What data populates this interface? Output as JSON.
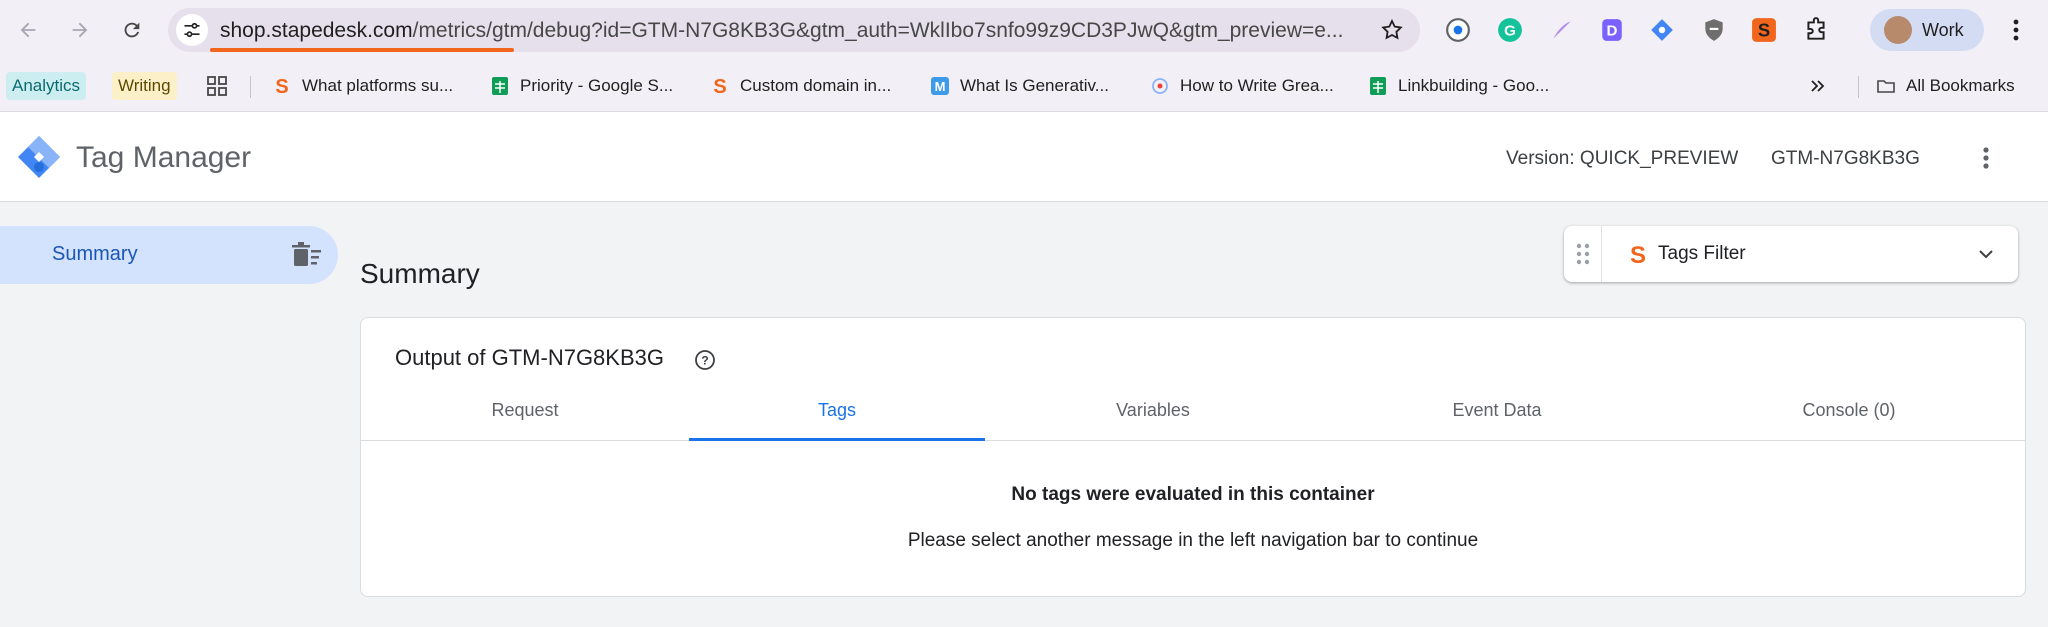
{
  "browser": {
    "url_host": "shop.stapedesk.com",
    "url_rest": "/metrics/gtm/debug?id=GTM-N7G8KB3G&gtm_auth=WklIbo7snfo99z9CD3PJwQ&gtm_preview=e...",
    "profile_label": "Work",
    "accent": "#f1661c"
  },
  "bookmarks": [
    {
      "label": "Analytics",
      "icon": "chip"
    },
    {
      "label": "Writing",
      "icon": "chip"
    },
    {
      "label": "What platforms su...",
      "icon": "stape-icon"
    },
    {
      "label": "Priority - Google S...",
      "icon": "sheets-icon"
    },
    {
      "label": "Custom domain in...",
      "icon": "stape-icon"
    },
    {
      "label": "What Is Generativ...",
      "icon": "m-icon"
    },
    {
      "label": "How to Write Grea...",
      "icon": "globe-icon"
    },
    {
      "label": "Linkbuilding - Goo...",
      "icon": "sheets-icon"
    },
    {
      "label": "All Bookmarks",
      "icon": "folder-icon"
    }
  ],
  "app": {
    "title": "Tag Manager",
    "version": "Version: QUICK_PREVIEW",
    "container_id": "GTM-N7G8KB3G"
  },
  "sidebar": {
    "items": [
      {
        "label": "Summary"
      }
    ]
  },
  "main": {
    "title": "Summary",
    "filter_label": "Tags Filter",
    "card_title": "Output of GTM-N7G8KB3G",
    "tabs": [
      {
        "label": "Request"
      },
      {
        "label": "Tags"
      },
      {
        "label": "Variables"
      },
      {
        "label": "Event Data"
      },
      {
        "label": "Console (0)"
      }
    ],
    "active_tab": "Tags",
    "empty_title": "No tags were evaluated in this container",
    "empty_subtitle": "Please select another message in the left navigation bar to continue"
  }
}
